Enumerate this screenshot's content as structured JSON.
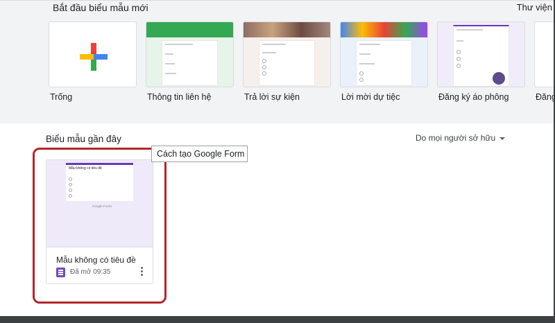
{
  "templates": {
    "title": "Bắt đầu biểu mẫu mới",
    "gallery_label": "Thư viện",
    "items": [
      {
        "label": "Trống"
      },
      {
        "label": "Thông tin liên hệ",
        "banner_color": "#34a853"
      },
      {
        "label": "Trả lời sự kiện"
      },
      {
        "label": "Lời mời dự tiệc"
      },
      {
        "label": "Đăng ký áo phông",
        "banner_color": "#673ab7"
      },
      {
        "label": "Đăng"
      }
    ]
  },
  "recent": {
    "title": "Biểu mẫu gần đây",
    "owner_filter": "Do mọi người sở hữu",
    "tooltip": "Cách tạo Google Form",
    "card": {
      "title": "Mẫu không có tiêu đề",
      "opened": "Đã mở 09:35",
      "thumb_title": "Mẫu không có tiêu đề",
      "thumb_footer": "Google Forms"
    }
  },
  "colors": {
    "accent": "#673ab7",
    "highlight": "#b3262b"
  }
}
